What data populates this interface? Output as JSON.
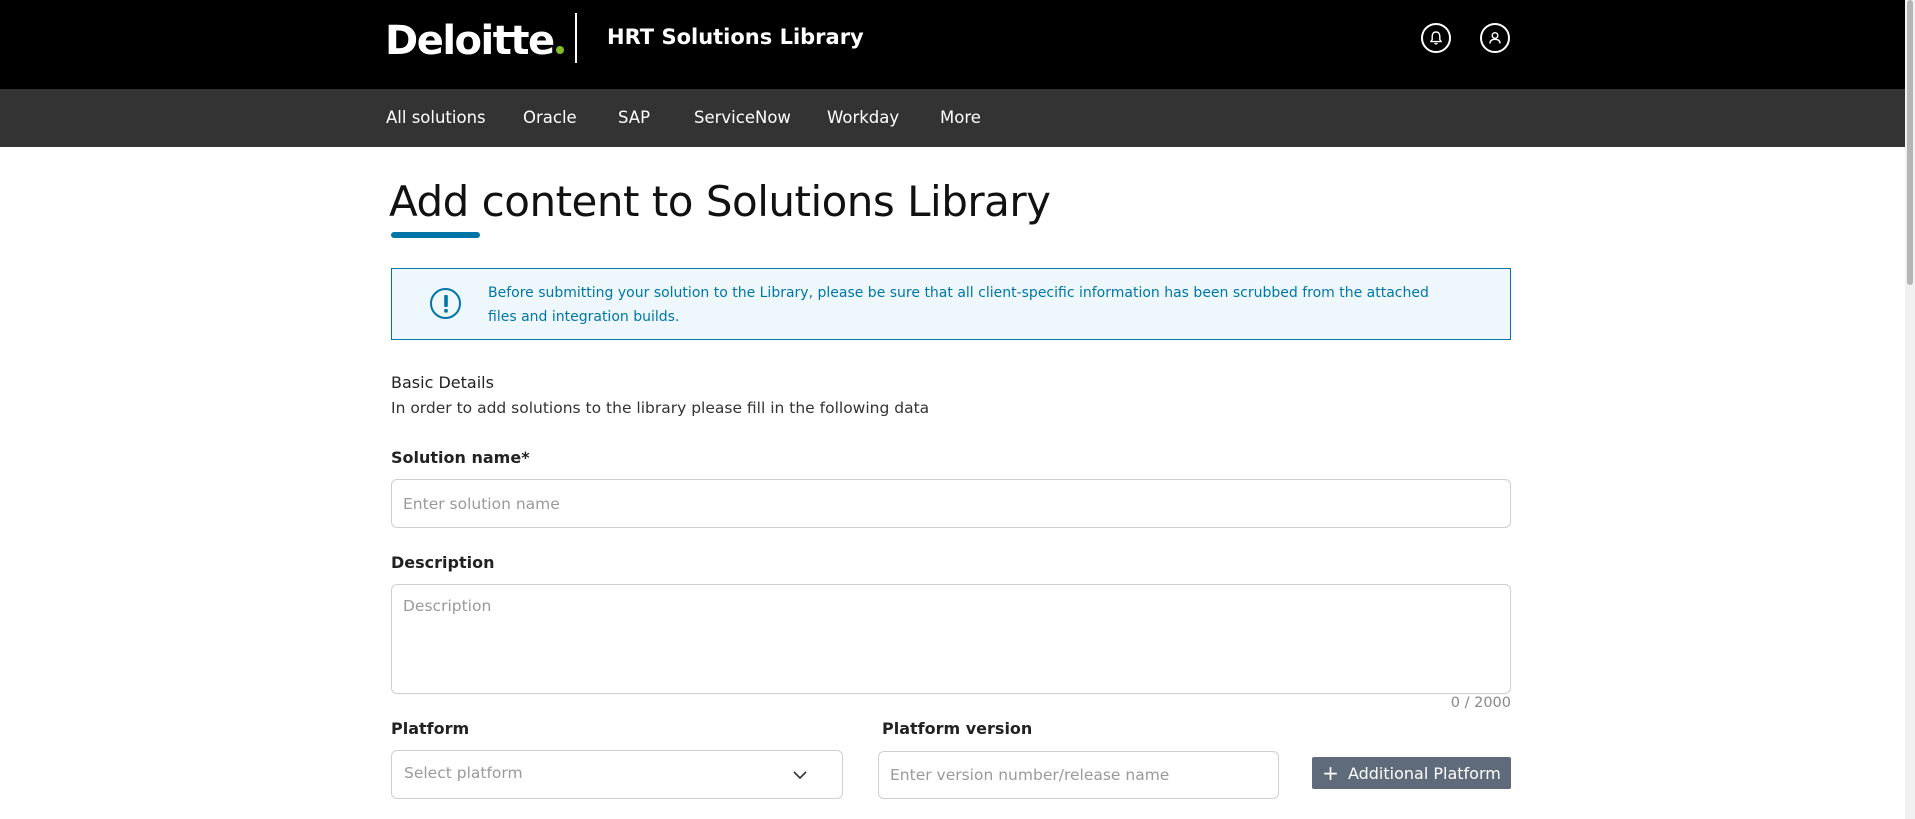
{
  "header": {
    "logo_text": "Deloitte",
    "app_title": "HRT Solutions Library",
    "logo_dot_color": "#86bc25",
    "icons": [
      "bell-icon",
      "user-icon"
    ]
  },
  "nav": {
    "items": [
      "All solutions",
      "Oracle",
      "SAP",
      "ServiceNow",
      "Workday",
      "More"
    ]
  },
  "main": {
    "page_title": "Add content to Solutions Library",
    "notice": {
      "icon": "exclamation-icon",
      "text": "Before submitting your solution to the Library, please be sure that all client-specific information has been scrubbed from the attached files and integration builds."
    },
    "section_title": "Basic Details",
    "section_subtitle": "In order to add solutions to the library please fill in the following data",
    "fields": {
      "solution_name": {
        "label": "Solution name*",
        "placeholder": "Enter solution name",
        "value": ""
      },
      "description": {
        "label": "Description",
        "placeholder": "Description",
        "value": "",
        "counter": "0 / 2000"
      },
      "platform": {
        "label": "Platform",
        "placeholder": "Select platform"
      },
      "platform_version": {
        "label": "Platform version",
        "placeholder": "Enter version number/release name",
        "value": ""
      }
    },
    "additional_platform_button": "Additional Platform",
    "accent_color": "#0076a8"
  }
}
